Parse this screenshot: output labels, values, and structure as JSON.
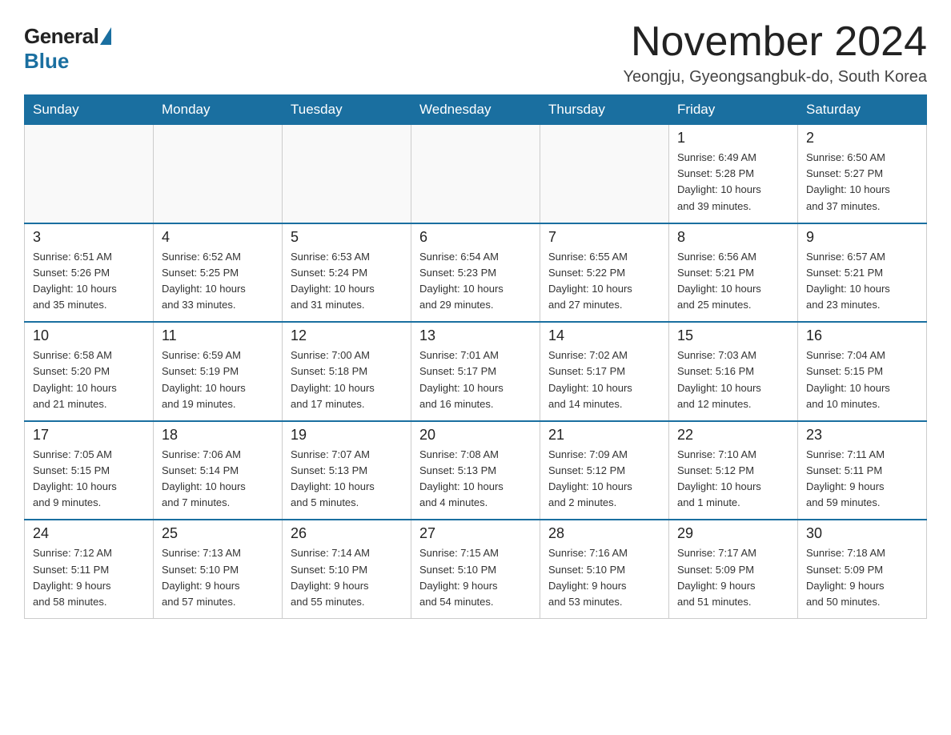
{
  "logo": {
    "general": "General",
    "blue": "Blue"
  },
  "header": {
    "month": "November 2024",
    "location": "Yeongju, Gyeongsangbuk-do, South Korea"
  },
  "weekdays": [
    "Sunday",
    "Monday",
    "Tuesday",
    "Wednesday",
    "Thursday",
    "Friday",
    "Saturday"
  ],
  "weeks": [
    [
      {
        "day": "",
        "info": ""
      },
      {
        "day": "",
        "info": ""
      },
      {
        "day": "",
        "info": ""
      },
      {
        "day": "",
        "info": ""
      },
      {
        "day": "",
        "info": ""
      },
      {
        "day": "1",
        "info": "Sunrise: 6:49 AM\nSunset: 5:28 PM\nDaylight: 10 hours\nand 39 minutes."
      },
      {
        "day": "2",
        "info": "Sunrise: 6:50 AM\nSunset: 5:27 PM\nDaylight: 10 hours\nand 37 minutes."
      }
    ],
    [
      {
        "day": "3",
        "info": "Sunrise: 6:51 AM\nSunset: 5:26 PM\nDaylight: 10 hours\nand 35 minutes."
      },
      {
        "day": "4",
        "info": "Sunrise: 6:52 AM\nSunset: 5:25 PM\nDaylight: 10 hours\nand 33 minutes."
      },
      {
        "day": "5",
        "info": "Sunrise: 6:53 AM\nSunset: 5:24 PM\nDaylight: 10 hours\nand 31 minutes."
      },
      {
        "day": "6",
        "info": "Sunrise: 6:54 AM\nSunset: 5:23 PM\nDaylight: 10 hours\nand 29 minutes."
      },
      {
        "day": "7",
        "info": "Sunrise: 6:55 AM\nSunset: 5:22 PM\nDaylight: 10 hours\nand 27 minutes."
      },
      {
        "day": "8",
        "info": "Sunrise: 6:56 AM\nSunset: 5:21 PM\nDaylight: 10 hours\nand 25 minutes."
      },
      {
        "day": "9",
        "info": "Sunrise: 6:57 AM\nSunset: 5:21 PM\nDaylight: 10 hours\nand 23 minutes."
      }
    ],
    [
      {
        "day": "10",
        "info": "Sunrise: 6:58 AM\nSunset: 5:20 PM\nDaylight: 10 hours\nand 21 minutes."
      },
      {
        "day": "11",
        "info": "Sunrise: 6:59 AM\nSunset: 5:19 PM\nDaylight: 10 hours\nand 19 minutes."
      },
      {
        "day": "12",
        "info": "Sunrise: 7:00 AM\nSunset: 5:18 PM\nDaylight: 10 hours\nand 17 minutes."
      },
      {
        "day": "13",
        "info": "Sunrise: 7:01 AM\nSunset: 5:17 PM\nDaylight: 10 hours\nand 16 minutes."
      },
      {
        "day": "14",
        "info": "Sunrise: 7:02 AM\nSunset: 5:17 PM\nDaylight: 10 hours\nand 14 minutes."
      },
      {
        "day": "15",
        "info": "Sunrise: 7:03 AM\nSunset: 5:16 PM\nDaylight: 10 hours\nand 12 minutes."
      },
      {
        "day": "16",
        "info": "Sunrise: 7:04 AM\nSunset: 5:15 PM\nDaylight: 10 hours\nand 10 minutes."
      }
    ],
    [
      {
        "day": "17",
        "info": "Sunrise: 7:05 AM\nSunset: 5:15 PM\nDaylight: 10 hours\nand 9 minutes."
      },
      {
        "day": "18",
        "info": "Sunrise: 7:06 AM\nSunset: 5:14 PM\nDaylight: 10 hours\nand 7 minutes."
      },
      {
        "day": "19",
        "info": "Sunrise: 7:07 AM\nSunset: 5:13 PM\nDaylight: 10 hours\nand 5 minutes."
      },
      {
        "day": "20",
        "info": "Sunrise: 7:08 AM\nSunset: 5:13 PM\nDaylight: 10 hours\nand 4 minutes."
      },
      {
        "day": "21",
        "info": "Sunrise: 7:09 AM\nSunset: 5:12 PM\nDaylight: 10 hours\nand 2 minutes."
      },
      {
        "day": "22",
        "info": "Sunrise: 7:10 AM\nSunset: 5:12 PM\nDaylight: 10 hours\nand 1 minute."
      },
      {
        "day": "23",
        "info": "Sunrise: 7:11 AM\nSunset: 5:11 PM\nDaylight: 9 hours\nand 59 minutes."
      }
    ],
    [
      {
        "day": "24",
        "info": "Sunrise: 7:12 AM\nSunset: 5:11 PM\nDaylight: 9 hours\nand 58 minutes."
      },
      {
        "day": "25",
        "info": "Sunrise: 7:13 AM\nSunset: 5:10 PM\nDaylight: 9 hours\nand 57 minutes."
      },
      {
        "day": "26",
        "info": "Sunrise: 7:14 AM\nSunset: 5:10 PM\nDaylight: 9 hours\nand 55 minutes."
      },
      {
        "day": "27",
        "info": "Sunrise: 7:15 AM\nSunset: 5:10 PM\nDaylight: 9 hours\nand 54 minutes."
      },
      {
        "day": "28",
        "info": "Sunrise: 7:16 AM\nSunset: 5:10 PM\nDaylight: 9 hours\nand 53 minutes."
      },
      {
        "day": "29",
        "info": "Sunrise: 7:17 AM\nSunset: 5:09 PM\nDaylight: 9 hours\nand 51 minutes."
      },
      {
        "day": "30",
        "info": "Sunrise: 7:18 AM\nSunset: 5:09 PM\nDaylight: 9 hours\nand 50 minutes."
      }
    ]
  ]
}
